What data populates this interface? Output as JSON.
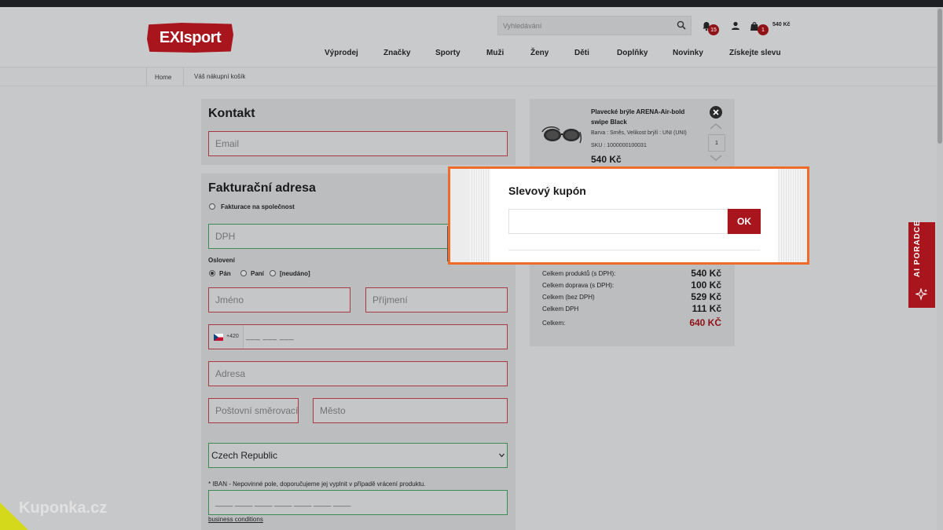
{
  "header": {
    "logo_text": "EXIsport",
    "search_placeholder": "Vyhledávání",
    "notifications_count": "15",
    "cart_count": "1",
    "cart_total": "540 Kč",
    "nav": [
      "Výprodej",
      "Značky",
      "Sporty",
      "Muži",
      "Ženy",
      "Děti",
      "Doplňky",
      "Novinky",
      "Získejte slevu"
    ]
  },
  "breadcrumb": {
    "home": "Home",
    "current": "Váš nákupní košík"
  },
  "contact": {
    "title": "Kontakt",
    "email_placeholder": "Email"
  },
  "billing": {
    "title": "Fakturační adresa",
    "company_label": "Fakturace na společnost",
    "vat_placeholder": "DPH",
    "salutation_label": "Oslovení",
    "salutation_options": [
      "Pán",
      "Paní",
      "[neudáno]"
    ],
    "first_name_placeholder": "Jméno",
    "last_name_placeholder": "Příjmení",
    "phone_prefix": "+420",
    "phone_mask": "___ ___ ___",
    "address_placeholder": "Adresa",
    "zip_placeholder": "Poštovní směrovací",
    "city_placeholder": "Město",
    "country": "Czech Republic",
    "iban_note": "* IBAN - Nepovinné pole, doporučujeme jej vyplnit v případě vrácení produktu.",
    "iban_mask": "____ ____ ____ ____ ____ ____ ____",
    "business_conditions": "business conditions"
  },
  "cart_item": {
    "name": "Plavecké brýle ARENA-Air-bold swipe Black",
    "variant": "Barva : Směs, Velikost brýlí : UNI (UNI)",
    "sku": "SKU : 1000000100031",
    "price": "540 Kč",
    "quantity": "1"
  },
  "summary": {
    "rows": [
      {
        "label": "Celkem produktů (s DPH):",
        "value": "540 Kč"
      },
      {
        "label": "Celkem doprava (s DPH):",
        "value": "100 Kč"
      },
      {
        "label": "Celkem (bez DPH)",
        "value": "529 Kč"
      },
      {
        "label": "Celkem DPH",
        "value": "111 Kč"
      }
    ],
    "total_label": "Celkem:",
    "total_value": "640 KČ"
  },
  "coupon_modal": {
    "title": "Slevový kupón",
    "input_value": "",
    "ok_label": "OK"
  },
  "ai_tab": {
    "label": "AI PORADCE"
  },
  "watermark": "Kuponka.cz",
  "colors": {
    "brand_red": "#a8151c",
    "modal_border": "#ef6b2a",
    "total_red": "#8f1217"
  }
}
